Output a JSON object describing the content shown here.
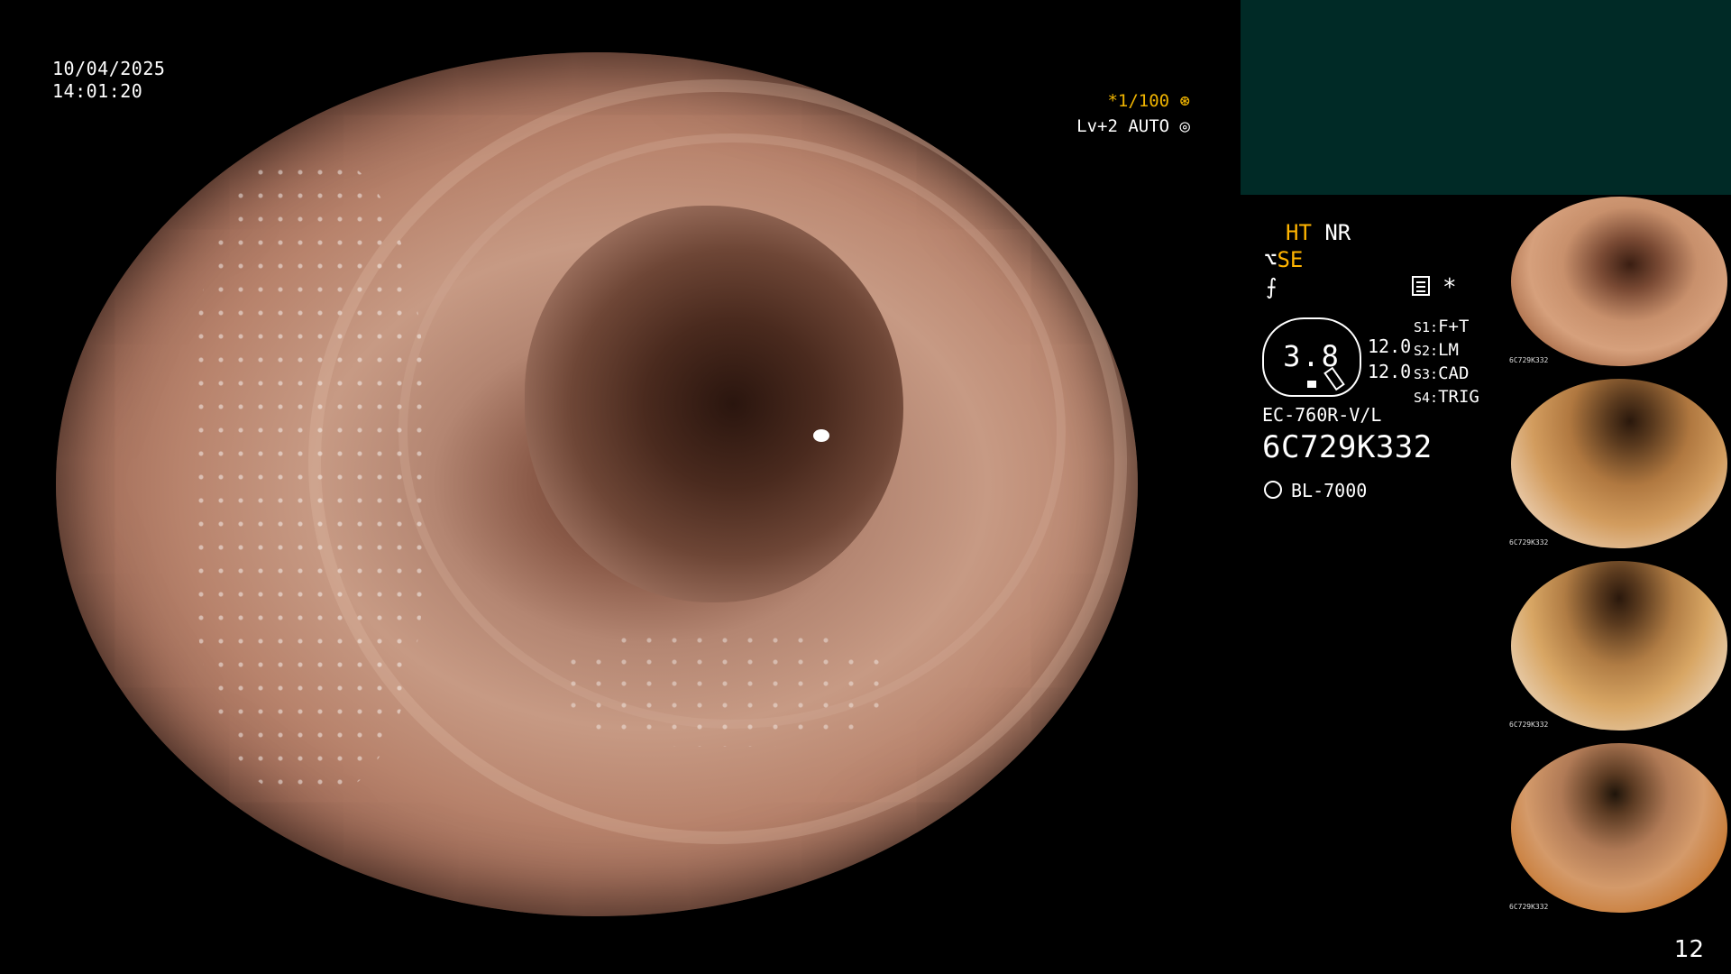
{
  "datetime": {
    "date": "10/04/2025",
    "time": "14:01:20"
  },
  "exposure": {
    "shutter": "*1/100",
    "shutter_icon": "aperture-icon",
    "level": "Lv+2 AUTO",
    "level_icon": "iris-icon"
  },
  "settings": {
    "ht": "HT",
    "nr": "NR",
    "se_prefix": "⌥",
    "se": "SE",
    "f_symbol": "⨍",
    "star": "*"
  },
  "gauge": {
    "value": "3.8",
    "left_vals": [
      "12.0",
      "12.0"
    ]
  },
  "switches": [
    {
      "key": "S1:",
      "value": "F+T"
    },
    {
      "key": "S2:",
      "value": "LM"
    },
    {
      "key": "S3:",
      "value": "CAD"
    },
    {
      "key": "S4:",
      "value": "TRIG"
    }
  ],
  "scope": {
    "model": "EC-760R-V/L",
    "serial": "6C729K332"
  },
  "light_source": {
    "icon": "light-source-icon",
    "name": "BL-7000"
  },
  "thumbnails": [
    {
      "serial": "6C729K332"
    },
    {
      "serial": "6C729K332"
    },
    {
      "serial": "6C729K332"
    },
    {
      "serial": "6C729K332"
    }
  ],
  "page_number": "12",
  "colors": {
    "accent_yellow": "#ffb400",
    "top_panel": "#002a26",
    "background": "#000000"
  }
}
